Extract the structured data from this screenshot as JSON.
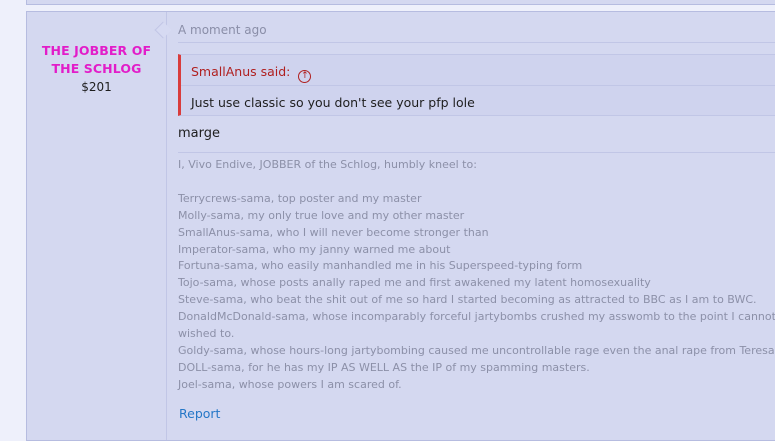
{
  "post": {
    "user": {
      "name": "THE JOBBER OF THE SCHLOG",
      "money": "$201"
    },
    "timestamp": "A moment ago",
    "quote": {
      "author": "SmallAnus said:",
      "text": "Just use classic so you don't see your pfp lole"
    },
    "message": "marge",
    "signature": {
      "intro": "I, Vivo Endive, JOBBER of the Schlog, humbly kneel to:",
      "lines": [
        "Terrycrews-sama, top poster and my master",
        "Molly-sama, my only true love and my other master",
        "SmallAnus-sama, who I will never become stronger than",
        "Imperator-sama, who my janny warned me about",
        "Fortuna-sama, who easily manhandled me in his Superspeed-typing form",
        "Tojo-sama, whose posts anally raped me and first awakened my latent homosexuality",
        "Steve-sama, who beat the shit out of me so hard I started becoming as attracted to BBC as I am to BWC.",
        "DonaldMcDonald-sama, whose incomparably forceful jartybombs crushed my asswomb to the point I cannot bea",
        "wished to.",
        "Goldy-sama, whose hours-long jartybombing caused me uncontrollable rage even the anal rape from Teresa can'",
        "DOLL-sama, for he has my IP AS WELL AS the IP of my spamming masters.",
        "Joel-sama, whose powers I am scared of."
      ]
    },
    "report_label": "Report"
  },
  "colors": {
    "username": "#e21dc9",
    "quote_border": "#d93c3c",
    "link": "#2577c7"
  }
}
